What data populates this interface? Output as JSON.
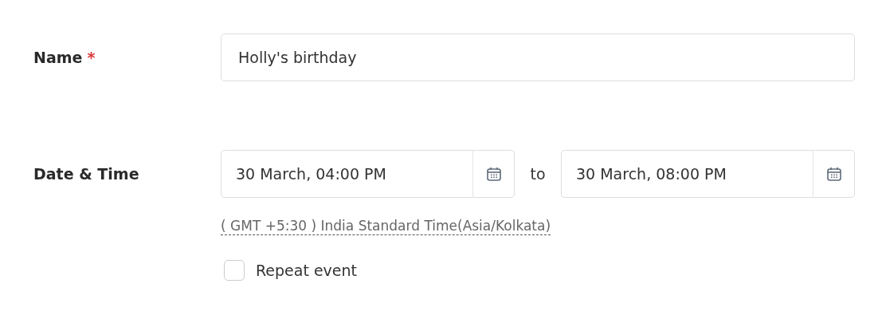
{
  "name_field": {
    "label": "Name",
    "required_mark": "*",
    "value": "Holly's birthday"
  },
  "date_time": {
    "label": "Date & Time",
    "start": "30 March, 04:00 PM",
    "separator": "to",
    "end": "30 March, 08:00 PM",
    "timezone": "( GMT +5:30 ) India Standard Time(Asia/Kolkata)"
  },
  "repeat": {
    "label": "Repeat event",
    "checked": false
  }
}
